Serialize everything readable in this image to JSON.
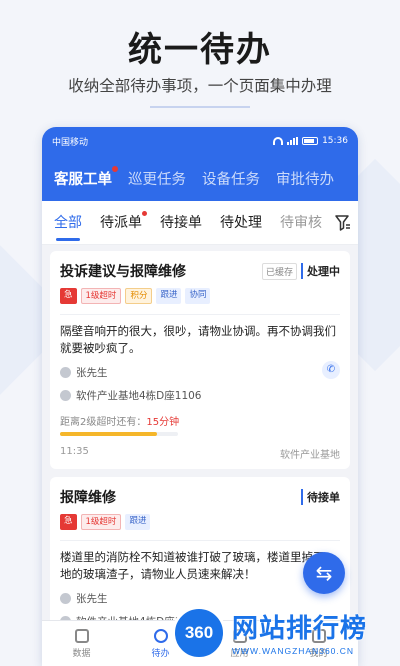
{
  "promo": {
    "title": "统一待办",
    "subtitle": "收纳全部待办事项，一个页面集中办理"
  },
  "status_bar": {
    "carrier": "中国移动",
    "time": "15:36"
  },
  "top_tabs": [
    {
      "label": "客服工单",
      "badge": true,
      "active": true
    },
    {
      "label": "巡更任务",
      "badge": false,
      "active": false
    },
    {
      "label": "设备任务",
      "badge": false,
      "active": false
    },
    {
      "label": "审批待办",
      "badge": false,
      "active": false
    }
  ],
  "sub_tabs": [
    {
      "label": "全部",
      "active": true
    },
    {
      "label": "待派单",
      "badge": true
    },
    {
      "label": "待接单"
    },
    {
      "label": "待处理"
    },
    {
      "label": "待审核"
    }
  ],
  "cards": [
    {
      "title": "投诉建议与报障维修",
      "cached": "已缓存",
      "status": "处理中",
      "tags": [
        "急",
        "1级超时",
        "积分",
        "跟进",
        "协同"
      ],
      "description": "隔壁音响开的很大，很吵，请物业协调。再不协调我们就要被吵疯了。",
      "contact": "张先生",
      "address": "软件产业基地4栋D座1106",
      "deadline_prefix": "距离2级超时还有：",
      "deadline_value": "15分钟",
      "progress": 0.82,
      "time": "11:35",
      "project": "软件产业基地"
    },
    {
      "title": "报障维修",
      "status": "待接单",
      "tags": [
        "急",
        "1级超时",
        "跟进"
      ],
      "description": "楼道里的消防栓不知道被谁打破了玻璃，楼道里掉了一地的玻璃渣子，请物业人员速来解决！",
      "contact": "张先生",
      "address": "软件产业基地4栋D座1106"
    }
  ],
  "bottom_nav": [
    {
      "label": "数据",
      "icon": "chart-icon"
    },
    {
      "label": "待办",
      "icon": "todo-icon",
      "active": true
    },
    {
      "label": "应用",
      "icon": "apps-icon"
    },
    {
      "label": "我的",
      "icon": "profile-icon"
    }
  ],
  "watermark": {
    "logo": "360",
    "name": "网站排行榜",
    "url": "WWW.WANGZHAN360.CN"
  },
  "colors": {
    "primary": "#2f6bea",
    "urgent": "#e53935",
    "warning": "#f5b62a"
  }
}
